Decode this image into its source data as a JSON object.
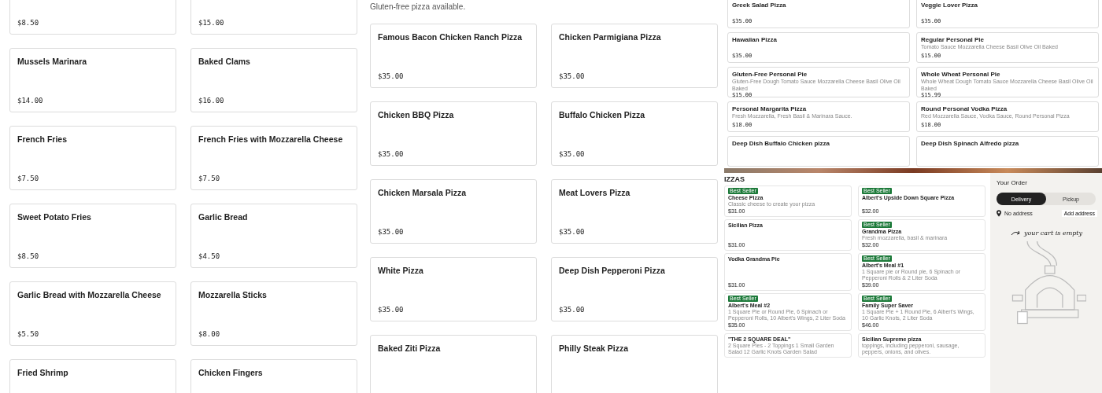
{
  "appetizers": {
    "items": [
      {
        "price": "$8.50"
      },
      {
        "price": "$15.00"
      },
      {
        "name": "Mussels Marinara",
        "price": "$14.00"
      },
      {
        "name": "Baked Clams",
        "price": "$16.00"
      },
      {
        "name": "French Fries",
        "price": "$7.50"
      },
      {
        "name": "French Fries with Mozzarella Cheese",
        "price": "$7.50"
      },
      {
        "name": "Sweet Potato Fries",
        "price": "$8.50"
      },
      {
        "name": "Garlic Bread",
        "price": "$4.50"
      },
      {
        "name": "Garlic Bread with Mozzarella Cheese",
        "price": "$5.50"
      },
      {
        "name": "Mozzarella Sticks",
        "price": "$8.00"
      },
      {
        "name": "Fried Shrimp"
      },
      {
        "name": "Chicken Fingers"
      }
    ]
  },
  "specialty_pizzas": {
    "note": "Gluten-free pizza available.",
    "items": [
      {
        "name": "Famous Bacon Chicken Ranch Pizza",
        "price": "$35.00"
      },
      {
        "name": "Chicken Parmigiana Pizza",
        "price": "$35.00"
      },
      {
        "name": "Chicken BBQ Pizza",
        "price": "$35.00"
      },
      {
        "name": "Buffalo Chicken Pizza",
        "price": "$35.00"
      },
      {
        "name": "Chicken Marsala Pizza",
        "price": "$35.00"
      },
      {
        "name": "Meat Lovers Pizza",
        "price": "$35.00"
      },
      {
        "name": "White Pizza",
        "price": "$35.00"
      },
      {
        "name": "Deep Dish Pepperoni Pizza",
        "price": "$35.00"
      },
      {
        "name": "Baked Ziti Pizza"
      },
      {
        "name": "Philly Steak Pizza"
      }
    ]
  },
  "more_pizzas": {
    "items": [
      {
        "name": "Greek Salad Pizza",
        "price": "$35.00"
      },
      {
        "name": "Veggie Lover Pizza",
        "price": "$35.00"
      },
      {
        "name": "Hawaiian Pizza",
        "price": "$35.00"
      },
      {
        "name": "Regular Personal Pie",
        "description": "Tomato Sauce Mozzarella Cheese Basil Olive Oil Baked",
        "price": "$15.00"
      },
      {
        "name": "Gluten-Free Personal Pie",
        "description": "Gluten-Free Dough Tomato Sauce Mozzarella Cheese Basil Olive Oil Baked",
        "price": "$15.00"
      },
      {
        "name": "Whole Wheat Personal Pie",
        "description": "Whole Wheat Dough Tomato Sauce Mozzarella Cheese Basil Olive Oil Baked",
        "price": "$15.99"
      },
      {
        "name": "Personal Margarita Pizza",
        "description": "Fresh Mozzarella, Fresh Basil & Marinara Sauce.",
        "price": "$18.00"
      },
      {
        "name": "Round Personal Vodka Pizza",
        "description": "Red Mozzarella Sauce, Vodka Sauce, Round Personal Pizza",
        "price": "$18.00"
      },
      {
        "name": "Deep Dish Buffalo Chicken pizza"
      },
      {
        "name": "Deep Dish Spinach Alfredo pizza"
      }
    ]
  },
  "inset_screen": {
    "section_title": "IZZAS",
    "items": [
      {
        "badge": "Best Seller",
        "name": "Cheese Pizza",
        "description": "Classic cheese to create your pizza",
        "price": "$31.00"
      },
      {
        "badge": "Best Seller",
        "name": "Albert's Upside Down Square Pizza",
        "price": "$32.00"
      },
      {
        "name": "Sicilian Pizza",
        "price": "$31.00"
      },
      {
        "badge": "Best Seller",
        "name": "Grandma Pizza",
        "description": "Fresh mozzarella, basil & marinara",
        "price": "$32.00"
      },
      {
        "name": "Vodka Grandma Pie",
        "price": "$31.00"
      },
      {
        "badge": "Best Seller",
        "name": "Albert's Meal #1",
        "description": "1 Square pie or Round pie, 6 Spinach or Pepperoni Rolls & 2 Liter Soda",
        "price": "$39.00"
      },
      {
        "badge": "Best Seller",
        "name": "Albert's Meal #2",
        "description": "1 Square Pie or Round Pie, 6 Spinach or Pepperoni Rolls, 10 Albert's Wings, 2 Liter Soda",
        "price": "$35.00"
      },
      {
        "badge": "Best Seller",
        "name": "Family Super Saver",
        "description": "1 Square Pie + 1 Round Pie, 6 Albert's Wings, 10 Garlic Knots, 2 Liter Soda",
        "price": "$46.00"
      },
      {
        "name": "\"THE 2 SQUARE DEAL\"",
        "description": "2 Square Pies - 2 Toppings 1 Small Garden Salad 12 Garlic Knots Garden Salad"
      },
      {
        "name": "Sicilian Supreme pizza",
        "description": "toppings, including pepperoni, sausage, peppers, onions, and olives."
      }
    ],
    "order": {
      "title": "Your Order",
      "tabs": [
        {
          "label": "Delivery",
          "selected": true
        },
        {
          "label": "Pickup",
          "selected": false
        }
      ],
      "address": "No address",
      "address_button": "Add address",
      "empty_message": "your cart is empty"
    }
  }
}
